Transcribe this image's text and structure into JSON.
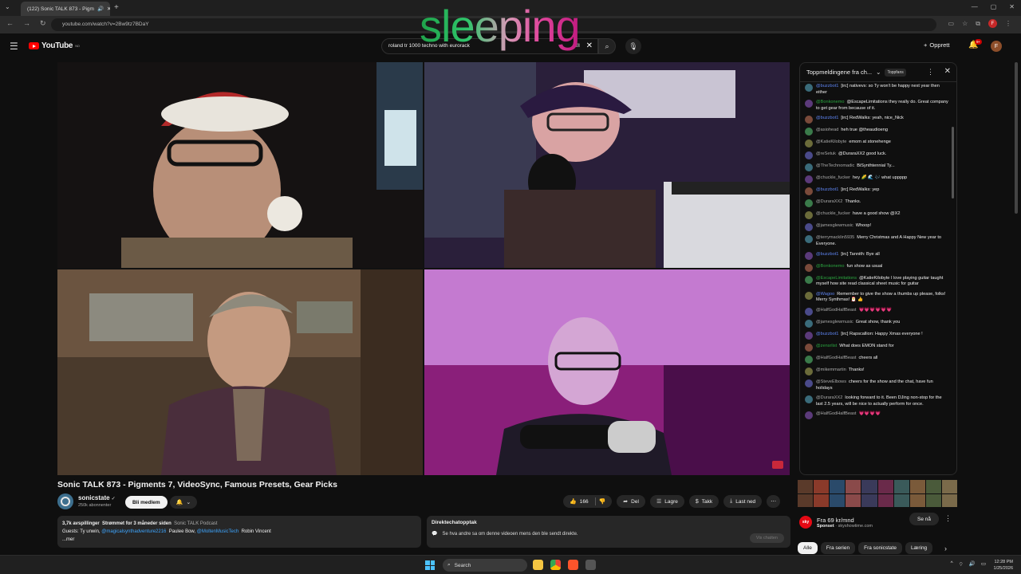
{
  "browser": {
    "tab_title": "(122) Sonic TALK 873 - Pigm",
    "new_tab": "+",
    "url": "youtube.com/watch?v=2Bw9tz7BDaY",
    "profile_initial": "F"
  },
  "youtube": {
    "logo_text": "YouTube",
    "logo_region": "NO",
    "search_value": "roland tr 1000 techno with eurorack",
    "create_label": "Opprett",
    "notif_badge": "9+",
    "avatar_initial": "F"
  },
  "overlay_text": "sleeping",
  "video": {
    "title": "Sonic TALK 873 - Pigments 7, VideoSync, Famous Presets, Gear Picks",
    "channel": "sonicstate",
    "verified_mark": "✓",
    "subscribers": "250k abonnenter",
    "join_label": "Bli medlem",
    "like_count": "166",
    "share_label": "Del",
    "save_label": "Lagre",
    "thanks_label": "Takk",
    "download_label": "Last ned"
  },
  "description": {
    "views": "3,7k avspillinger",
    "streamed": "Strømmet for 3 måneder siden",
    "podcast": "Sonic TALK Podcast",
    "guests_prefix": "Guests: Ty unwin,",
    "guest_link1": "@magicalsynthadventure2216",
    "guest2": "Paulee Bow,",
    "guest_link2": "@MoltenMusicTech",
    "guest3": "Robin Vincent",
    "more": "...mer"
  },
  "replay": {
    "heading": "Direktechatopptak",
    "text": "Se hva andre sa om denne videoen mens den ble sendt direkte.",
    "button": "Vis chatten"
  },
  "chat": {
    "header": "Toppmeldingene fra ch...",
    "top_label": "Toppfans",
    "messages": [
      {
        "author": "@buzzbot1",
        "text": "[irc] nativevs: so Ty won't be happy next year then either",
        "c": "b"
      },
      {
        "author": "@Bonkonemo",
        "text": "@EscapeLimitations they really do. Great company to get gear from because of it.",
        "c": "g"
      },
      {
        "author": "@buzzbot1",
        "text": "[irc] RedWalks: yeah, nice_Nick",
        "c": "b"
      },
      {
        "author": "@asiohead",
        "text": "heh true @theaudioeng",
        "c": ""
      },
      {
        "author": "@KatieKilobyte",
        "text": "emom at stonehenge",
        "c": ""
      },
      {
        "author": "@reSetuk",
        "text": "@DuraraXX2 good luck.",
        "c": ""
      },
      {
        "author": "@TheTechnomadic",
        "text": "BiSynthtennial Ty...",
        "c": ""
      },
      {
        "author": "@chuckle_fucker",
        "text": "hey 🌽 🌊 🎶 what uppppp",
        "c": ""
      },
      {
        "author": "@buzzbot1",
        "text": "[irc] RedWalks: yep",
        "c": "b"
      },
      {
        "author": "@DuraraXX2",
        "text": "Thanks.",
        "c": ""
      },
      {
        "author": "@chuckle_fucker",
        "text": "have a good show @X2",
        "c": ""
      },
      {
        "author": "@jamesglewmusic",
        "text": "Whoop!",
        "c": ""
      },
      {
        "author": "@terrymacklin5935",
        "text": "Merry Christmas and A Happy New year to Everyone.",
        "c": ""
      },
      {
        "author": "@buzzbot1",
        "text": "[irc] Tannith: Bye all",
        "c": "b"
      },
      {
        "author": "@Bonkonemo",
        "text": "fun show as usual",
        "c": "g"
      },
      {
        "author": "@EscapeLimitations",
        "text": "@KatieKilobyte I love playing guitar taught myself how site read classical sheet music for guitar",
        "c": "g"
      },
      {
        "author": "@Wagoo",
        "text": "Remember to give the show a thumbs up please, folks! Merry Synthmas! 🎅 👍",
        "c": "b"
      },
      {
        "author": "@HalfGodHalfBeast",
        "text": "💗💗💗💗💗💗",
        "c": ""
      },
      {
        "author": "@jamesglewmusic",
        "text": "Great show, thank you",
        "c": ""
      },
      {
        "author": "@buzzbot1",
        "text": "[irc] Rapscallion: Happy Xmas everyone !",
        "c": "b"
      },
      {
        "author": "@zensrlist",
        "text": "What does EMON stand for",
        "c": "g"
      },
      {
        "author": "@HalfGodHalfBeast",
        "text": "cheers all",
        "c": ""
      },
      {
        "author": "@mikemmartin",
        "text": "Thanks!",
        "c": ""
      },
      {
        "author": "@SteveElbows",
        "text": "cheers for the show and the chat, have fun holidays",
        "c": ""
      },
      {
        "author": "@DuraraXX2",
        "text": "looking forward to it. Been DJing non-stop for the last 2.5 years, will be nice to actually perform for once.",
        "c": ""
      },
      {
        "author": "@HalfGodHalfBeast",
        "text": "💗💗💗💗",
        "c": ""
      }
    ]
  },
  "ad": {
    "brand_short": "sky",
    "headline": "Fra 69 kr/mnd",
    "sponsored": "Sponset",
    "domain": "skyshowtime.com",
    "cta": "Se nå"
  },
  "chips": [
    "Alle",
    "Fra serien",
    "Fra sonicstate",
    "Læring"
  ],
  "taskbar": {
    "search": "Search",
    "time": "12:28 PM",
    "date": "1/25/2026"
  },
  "colors": {
    "accent": "#ff0000",
    "link": "#3ea6ff",
    "overlay_start": "#1fa34a",
    "overlay_end": "#c01a7f"
  }
}
